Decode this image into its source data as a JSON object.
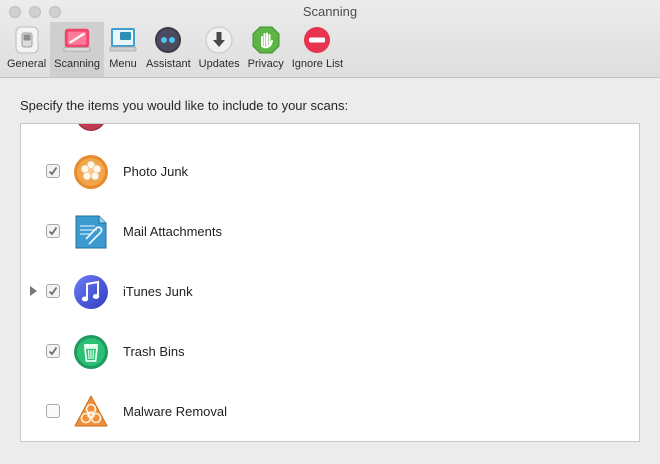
{
  "window": {
    "title": "Scanning"
  },
  "toolbar": {
    "items": [
      {
        "label": "General",
        "icon": "general-switch-icon"
      },
      {
        "label": "Scanning",
        "icon": "scanning-icon",
        "selected": true
      },
      {
        "label": "Menu",
        "icon": "menu-icon"
      },
      {
        "label": "Assistant",
        "icon": "assistant-icon"
      },
      {
        "label": "Updates",
        "icon": "download-arrow-icon"
      },
      {
        "label": "Privacy",
        "icon": "privacy-hand-icon"
      },
      {
        "label": "Ignore List",
        "icon": "ignore-minus-icon"
      }
    ]
  },
  "main": {
    "instructions": "Specify the items you would like to include to your scans:",
    "items": [
      {
        "label": "Photo Junk",
        "checked": true,
        "expandable": false,
        "icon": "photo-junk-icon"
      },
      {
        "label": "Mail Attachments",
        "checked": true,
        "expandable": false,
        "icon": "mail-attachments-icon"
      },
      {
        "label": "iTunes Junk",
        "checked": true,
        "expandable": true,
        "icon": "itunes-note-icon"
      },
      {
        "label": "Trash Bins",
        "checked": true,
        "expandable": false,
        "icon": "trash-bin-icon"
      },
      {
        "label": "Malware Removal",
        "checked": false,
        "expandable": false,
        "icon": "biohazard-icon"
      }
    ]
  },
  "colors": {
    "selected_tab_bg": "#cfcfcf",
    "scanning_pink": "#f0456c",
    "privacy_green": "#5cb545",
    "ignore_red": "#e8334e"
  }
}
